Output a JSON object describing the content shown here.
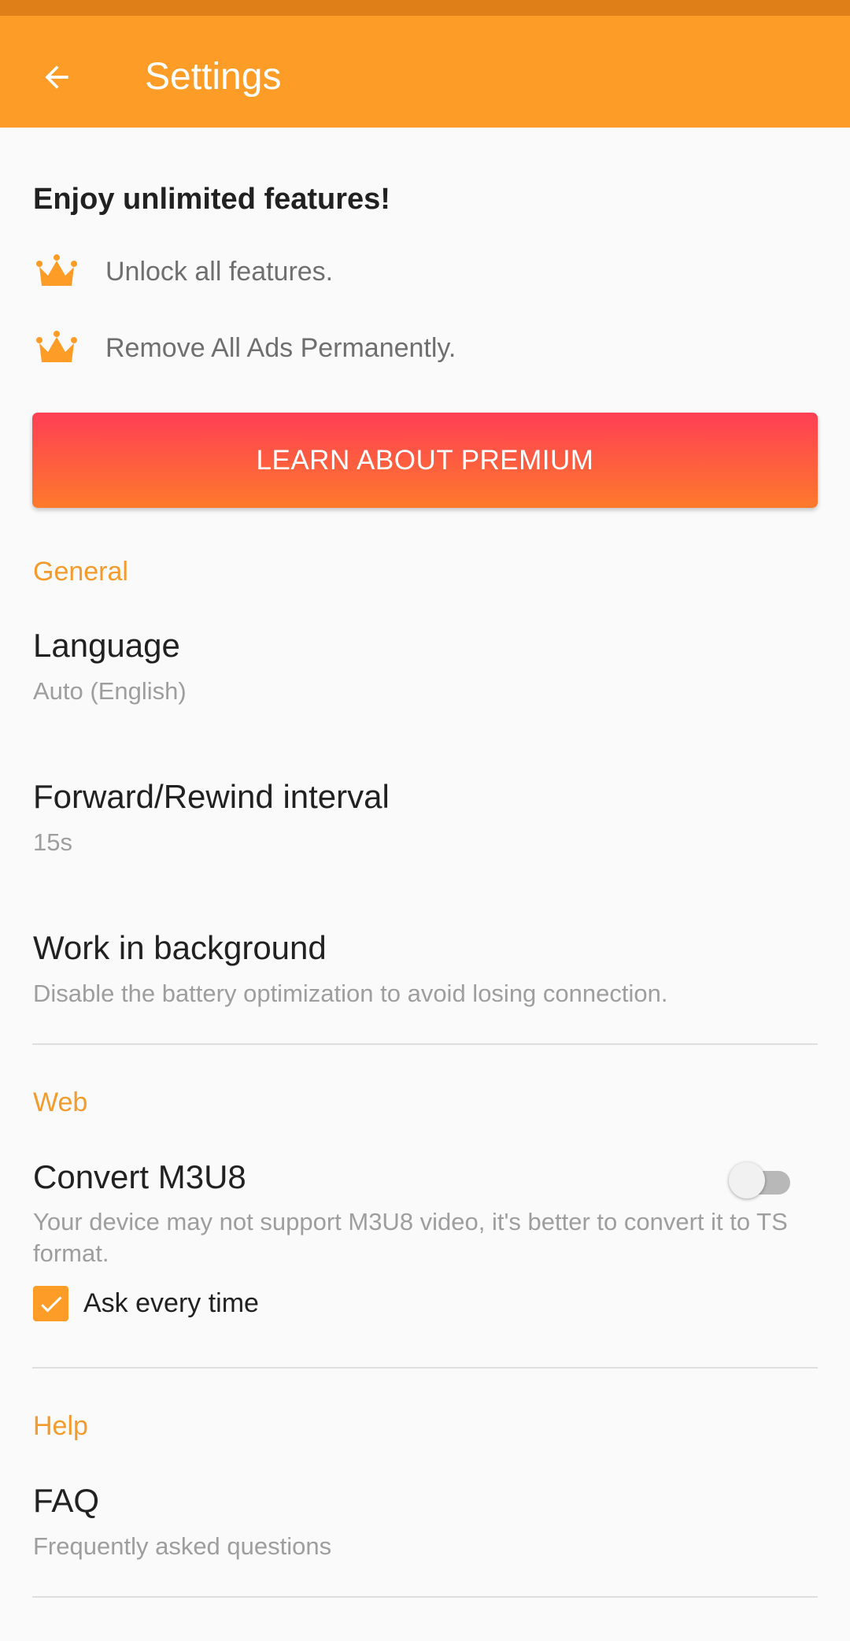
{
  "app_bar": {
    "title": "Settings",
    "back_icon": "arrow-back-icon",
    "color": "#fe9c28"
  },
  "promo": {
    "title": "Enjoy unlimited features!",
    "features": [
      {
        "icon": "crown-icon",
        "text": "Unlock all features."
      },
      {
        "icon": "crown-icon",
        "text": "Remove All Ads Permanently."
      }
    ],
    "button_label": "LEARN ABOUT PREMIUM"
  },
  "sections": {
    "general": {
      "header": "General",
      "language": {
        "title": "Language",
        "summary": "Auto (English)"
      },
      "interval": {
        "title": "Forward/Rewind interval",
        "summary": "15s"
      },
      "background": {
        "title": "Work in background",
        "summary": "Disable the battery optimization to avoid losing connection."
      }
    },
    "web": {
      "header": "Web",
      "convert": {
        "title": "Convert M3U8",
        "summary": "Your device may not support M3U8 video, it's better to convert it to TS format.",
        "enabled": false
      },
      "ask": {
        "label": "Ask every time",
        "checked": true
      }
    },
    "help": {
      "header": "Help",
      "faq": {
        "title": "FAQ",
        "summary": "Frequently asked questions"
      }
    }
  },
  "colors": {
    "accent": "#fe9c28",
    "section_header": "#f39b2c",
    "premium_gradient_top": "#fe3e55",
    "premium_gradient_bottom": "#fe7a2c"
  }
}
